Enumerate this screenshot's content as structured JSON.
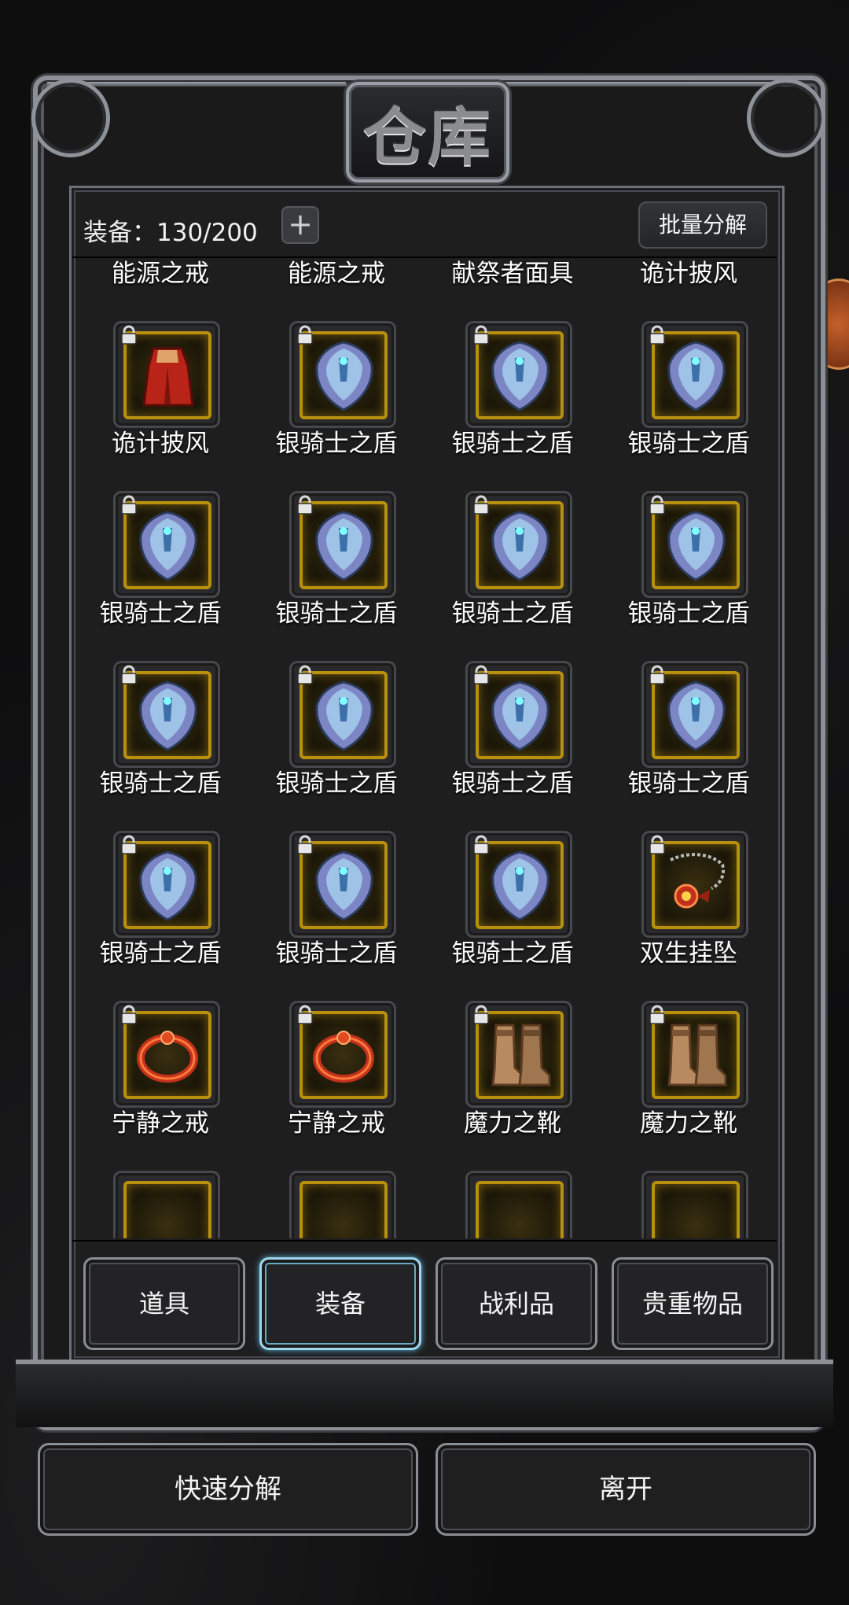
{
  "window": {
    "title": "仓库"
  },
  "header": {
    "capacity_label": "装备：130/200",
    "plus_label": "+",
    "batch_label": "批量分解"
  },
  "items": [
    {
      "name": "能源之戒",
      "icon": "ring-icon"
    },
    {
      "name": "能源之戒",
      "icon": "ring-icon"
    },
    {
      "name": "献祭者面具",
      "icon": "mask-icon"
    },
    {
      "name": "诡计披风",
      "icon": "cloak-icon"
    },
    {
      "name": "诡计披风",
      "icon": "cloak-icon"
    },
    {
      "name": "银骑士之盾",
      "icon": "shield-icon"
    },
    {
      "name": "银骑士之盾",
      "icon": "shield-icon"
    },
    {
      "name": "银骑士之盾",
      "icon": "shield-icon"
    },
    {
      "name": "银骑士之盾",
      "icon": "shield-icon"
    },
    {
      "name": "银骑士之盾",
      "icon": "shield-icon"
    },
    {
      "name": "银骑士之盾",
      "icon": "shield-icon"
    },
    {
      "name": "银骑士之盾",
      "icon": "shield-icon"
    },
    {
      "name": "银骑士之盾",
      "icon": "shield-icon"
    },
    {
      "name": "银骑士之盾",
      "icon": "shield-icon"
    },
    {
      "name": "银骑士之盾",
      "icon": "shield-icon"
    },
    {
      "name": "银骑士之盾",
      "icon": "shield-icon"
    },
    {
      "name": "银骑士之盾",
      "icon": "shield-icon"
    },
    {
      "name": "银骑士之盾",
      "icon": "shield-icon"
    },
    {
      "name": "银骑士之盾",
      "icon": "shield-icon"
    },
    {
      "name": "双生挂坠",
      "icon": "pendant-icon"
    },
    {
      "name": "宁静之戒",
      "icon": "ring-icon"
    },
    {
      "name": "宁静之戒",
      "icon": "ring-icon"
    },
    {
      "name": "魔力之靴",
      "icon": "boots-icon"
    },
    {
      "name": "魔力之靴",
      "icon": "boots-icon"
    }
  ],
  "tabs": [
    {
      "label": "道具",
      "active": false
    },
    {
      "label": "装备",
      "active": true
    },
    {
      "label": "战利品",
      "active": false
    },
    {
      "label": "贵重物品",
      "active": false
    }
  ],
  "actions": {
    "quick_dismantle_label": "快速分解",
    "leave_label": "离开"
  },
  "colors": {
    "slot_gold": "#b8900e",
    "active_tab": "#9fd4ea"
  }
}
